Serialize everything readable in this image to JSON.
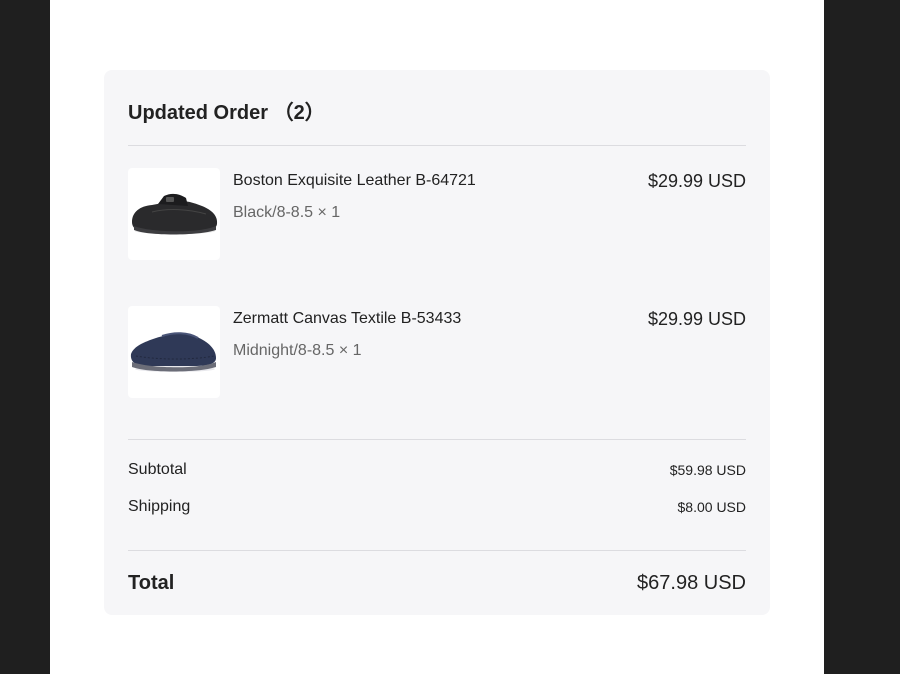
{
  "order": {
    "title": "Updated Order （2）",
    "items": [
      {
        "name": "Boston Exquisite Leather B-64721",
        "variant": "Black/8-8.5 × 1",
        "price": "$29.99 USD",
        "image_icon": "black-leather-clog-image"
      },
      {
        "name": "Zermatt Canvas Textile B-53433",
        "variant": "Midnight/8-8.5 × 1",
        "price": "$29.99 USD",
        "image_icon": "navy-textile-slipper-image"
      }
    ],
    "summary": {
      "subtotal_label": "Subtotal",
      "subtotal_value": "$59.98 USD",
      "shipping_label": "Shipping",
      "shipping_value": "$8.00 USD",
      "total_label": "Total",
      "total_value": "$67.98 USD"
    }
  }
}
